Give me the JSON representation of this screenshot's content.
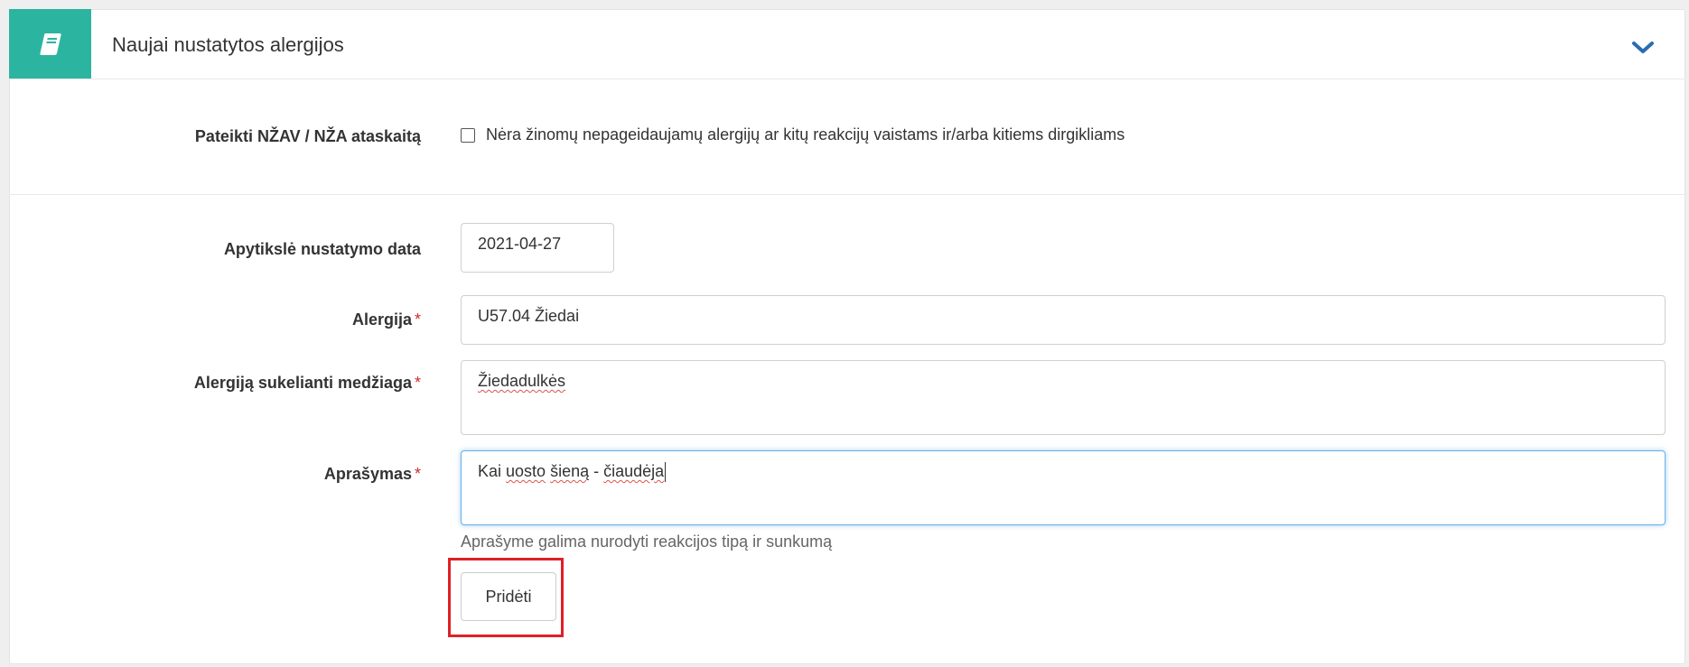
{
  "panel": {
    "title": "Naujai nustatytos alergijos",
    "icon": "book-icon",
    "collapse_icon": "chevron-down-icon",
    "accent_color": "#2bb5a1"
  },
  "report": {
    "label": "Pateikti NŽAV / NŽA ataskaitą",
    "checkbox_label": "Nėra žinomų nepageidaujamų alergijų ar kitų reakcijų vaistams ir/arba kitiems dirgikliams",
    "checked": false
  },
  "form": {
    "date": {
      "label": "Apytikslė nustatymo data",
      "value": "2021-04-27"
    },
    "allergy": {
      "label": "Alergija",
      "required_mark": "*",
      "value": "U57.04 Žiedai"
    },
    "substance": {
      "label": "Alergiją sukelianti medžiaga",
      "required_mark": "*",
      "value": "Žiedadulkės"
    },
    "description": {
      "label": "Aprašymas",
      "required_mark": "*",
      "value_parts": [
        "Kai ",
        "uosto",
        " ",
        "šieną",
        " - ",
        "čiaudėja"
      ],
      "help": "Aprašyme galima nurodyti reakcijos tipą ir sunkumą"
    },
    "add_button": "Pridėti"
  }
}
